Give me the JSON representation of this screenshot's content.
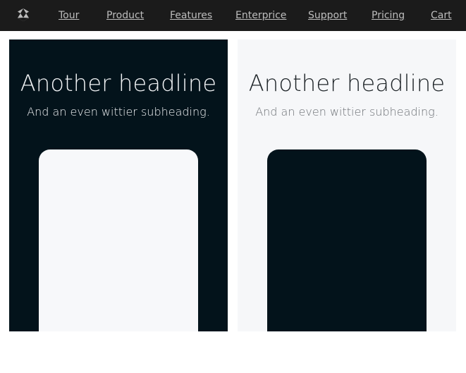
{
  "nav": {
    "logo_icon": "logo-icon",
    "items": [
      {
        "label": "Tour"
      },
      {
        "label": "Product"
      },
      {
        "label": "Features"
      },
      {
        "label": "Enterprice"
      },
      {
        "label": "Support"
      },
      {
        "label": "Pricing"
      },
      {
        "label": "Cart"
      }
    ]
  },
  "panels": [
    {
      "headline": "Another headline",
      "subheading": "And an even wittier subheading."
    },
    {
      "headline": "Another headline",
      "subheading": "And an even wittier subheading."
    }
  ],
  "colors": {
    "nav_bg": "#1b1b1b",
    "dark_panel_bg": "#03131b",
    "light_panel_bg": "#f6f7f9",
    "nav_link_text": "#bdbdbd"
  }
}
